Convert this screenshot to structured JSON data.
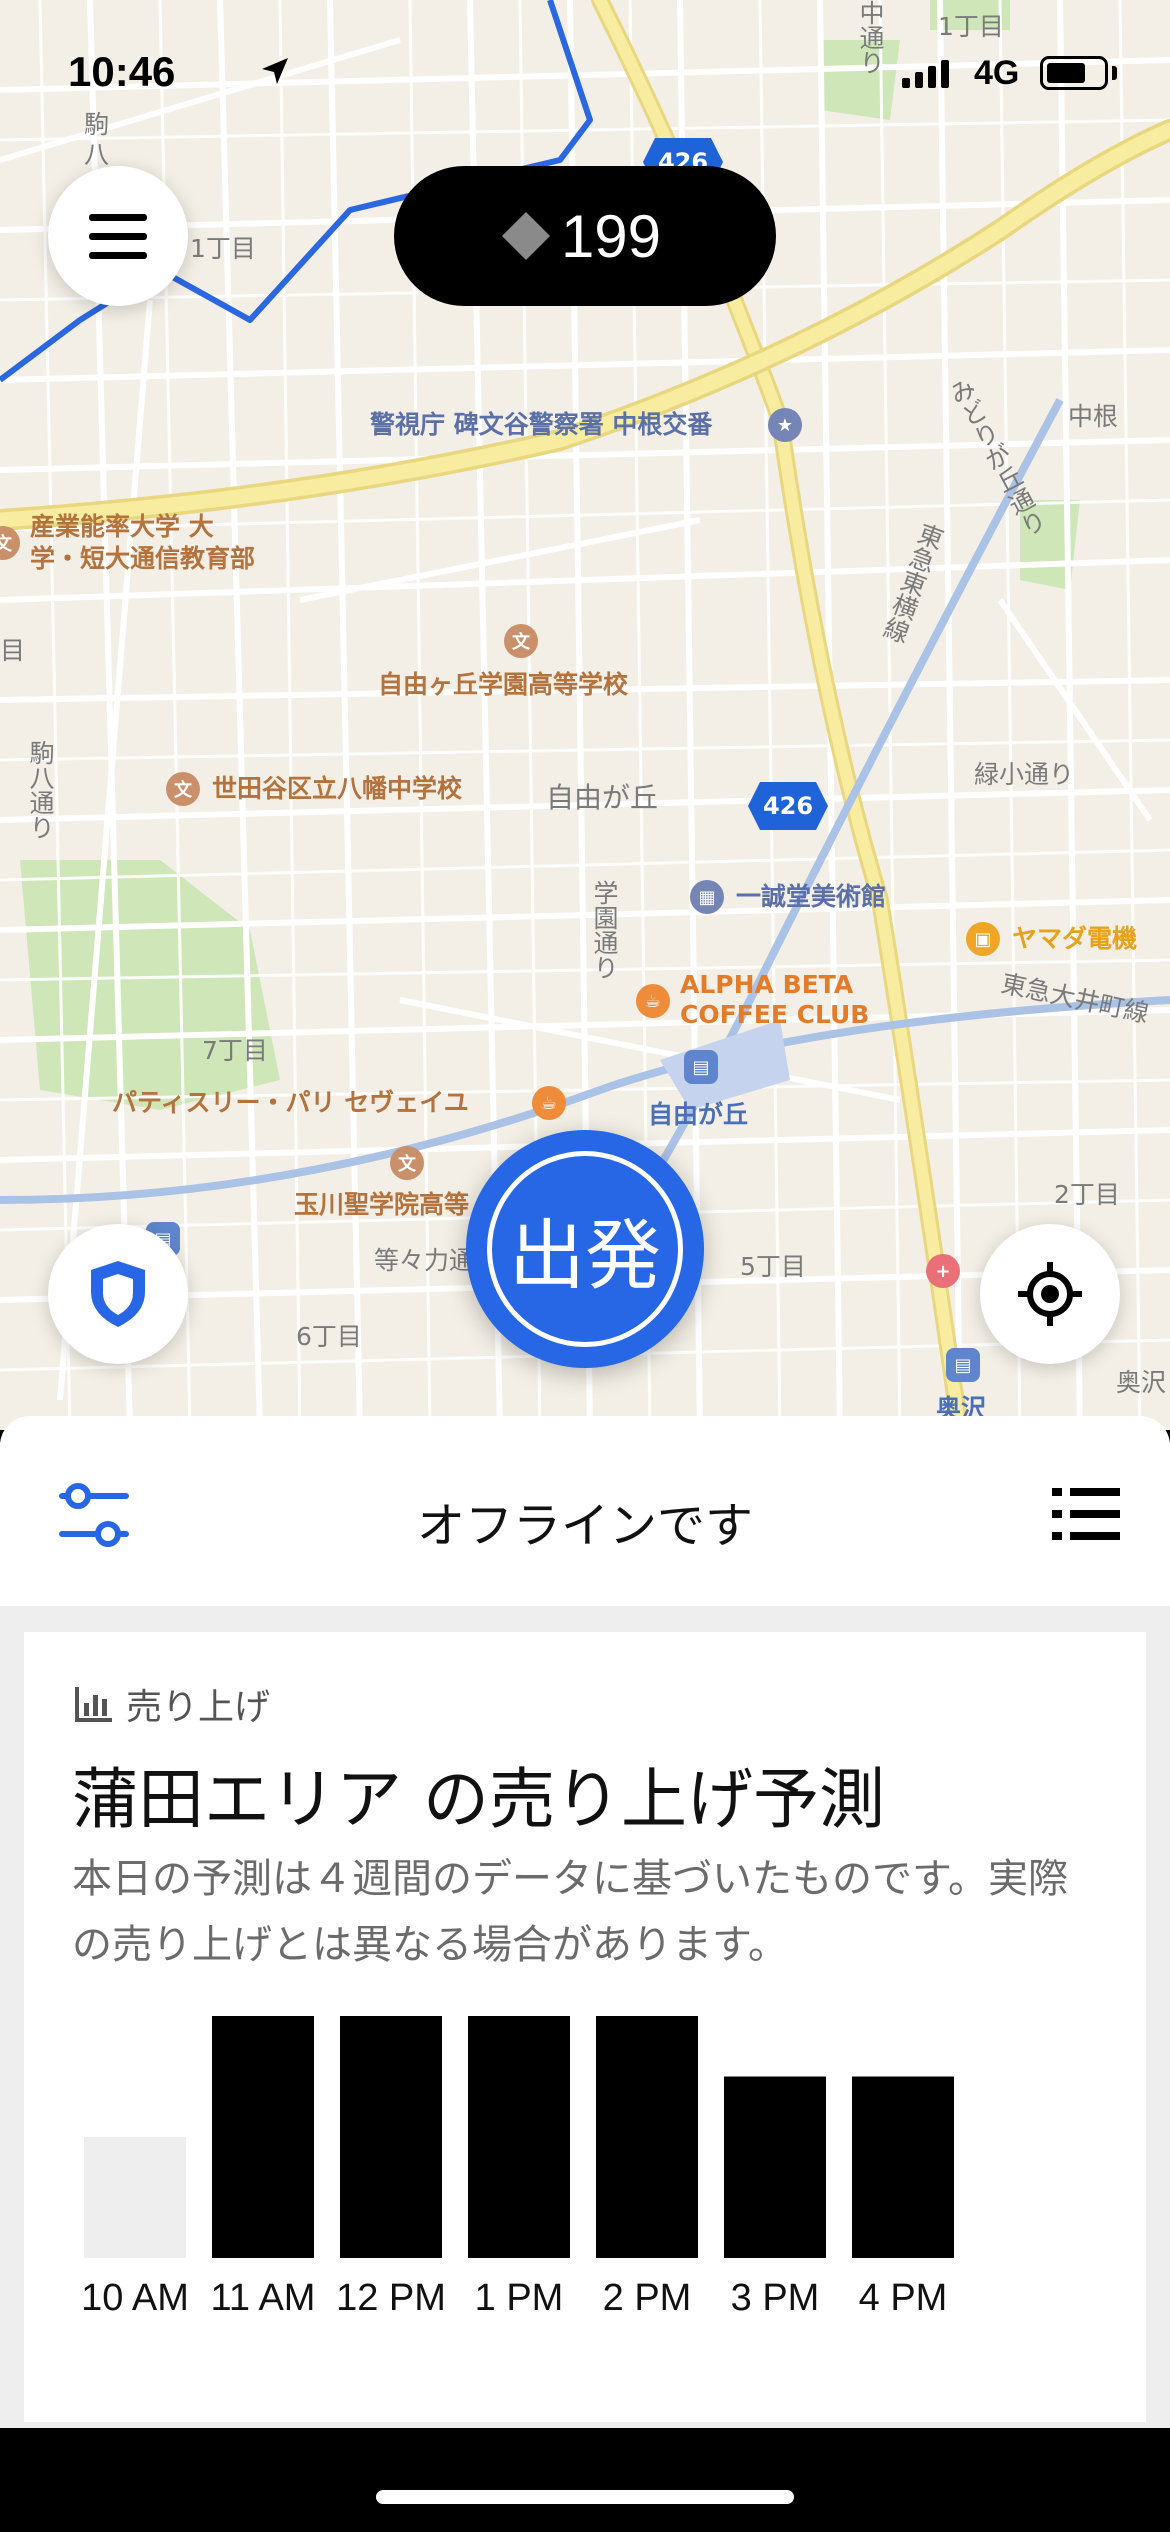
{
  "status_bar": {
    "time": "10:46",
    "network": "4G"
  },
  "header": {
    "points": "199"
  },
  "map": {
    "labels": {
      "kanji_1": "駒",
      "kanji_2": "八",
      "block_1": "1丁目",
      "block_top_right": "1丁目",
      "naka_road_top": "中通り",
      "police": "警視庁 碑文谷警察署 中根交番",
      "nakane": "中根",
      "midorigaoka_road": "みどりが丘通り",
      "toyoko_line": "東急東横線",
      "sanno_1": "産業能率大学 大",
      "sanno_2": "学・短大通信教育部",
      "block_left": "目",
      "jiyugaoka_high": "自由ヶ丘学園高等学校",
      "koma_road": "駒八通り",
      "yahata_jhs": "世田谷区立八幡中学校",
      "jiyugaoka_area": "自由が丘",
      "midorisho_road": "緑小通り",
      "gakuen_road": "学園通り",
      "isseido": "一誠堂美術館",
      "yamada": "ヤマダ電機",
      "alpha_1": "ALPHA BETA",
      "alpha_2": "COFFEE CLUB",
      "oimachi_line": "東急大井町線",
      "block_7": "7丁目",
      "patisserie": "パティスリー・パリ セヴェイユ",
      "jiyugaoka_station": "自由が丘",
      "tamagawa": "玉川聖学院高等",
      "block_2": "2丁目",
      "todoroki": "等々力通",
      "block_5": "5丁目",
      "block_6": "6丁目",
      "okusawa": "奥沢",
      "okusawa_station": "奥沢",
      "route_number": "426",
      "route_number_2": "426"
    }
  },
  "go_button": {
    "label": "出発"
  },
  "sheet": {
    "status": "オフラインです"
  },
  "card": {
    "category": "売り上げ",
    "title": "蒲田エリア の売り上げ予測",
    "description": "本日の予測は４週間のデータに基づいたものです。実際の売り上げとは異なる場合があります。"
  },
  "colors": {
    "accent": "#2767e6",
    "bar_active": "#000000",
    "bar_inactive": "#eeeeee"
  },
  "chart_data": {
    "type": "bar",
    "categories": [
      "10 AM",
      "11 AM",
      "12 PM",
      "1 PM",
      "2 PM",
      "3 PM",
      "4 PM"
    ],
    "values": [
      3,
      6,
      6,
      6,
      6,
      4.5,
      4.5
    ],
    "ylim": [
      0,
      6
    ],
    "title": "",
    "xlabel": "",
    "ylabel": "",
    "grid": false,
    "highlight": [
      false,
      true,
      true,
      true,
      true,
      true,
      true
    ]
  }
}
